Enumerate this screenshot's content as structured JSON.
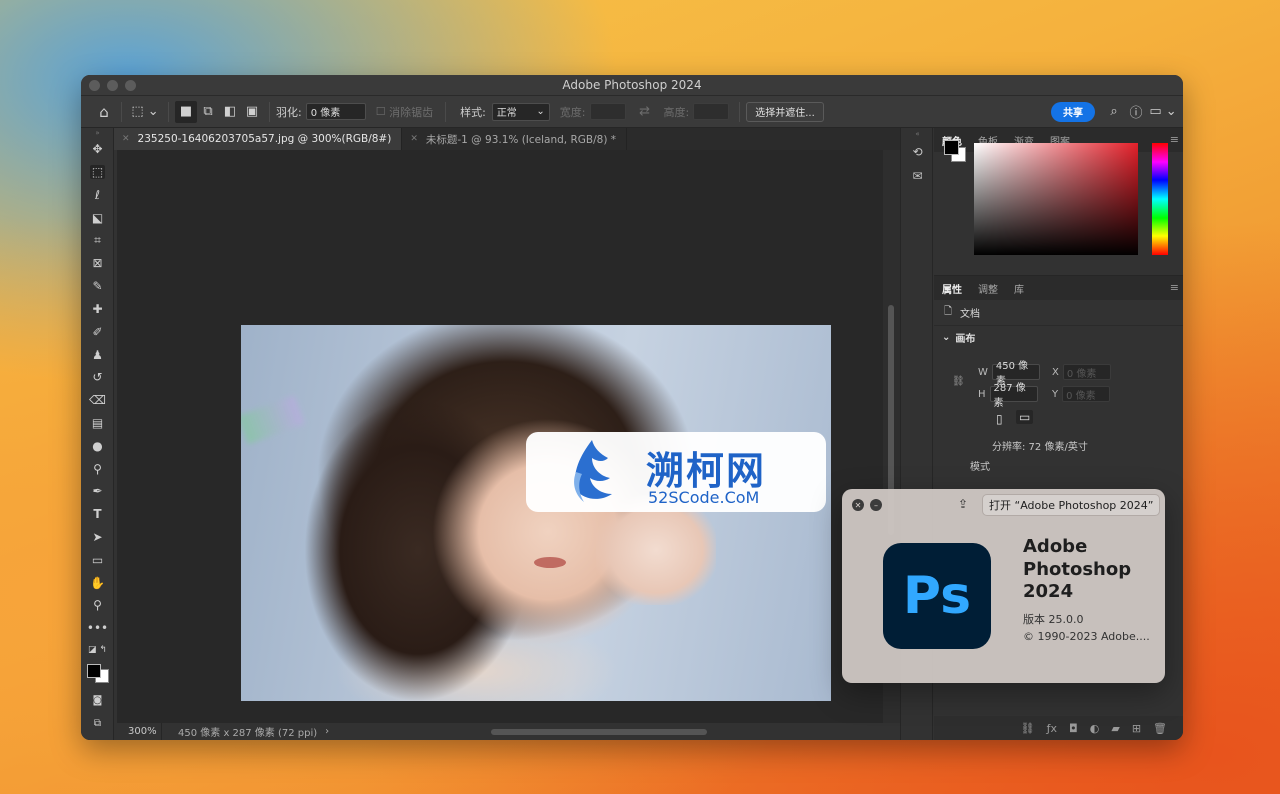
{
  "window": {
    "title": "Adobe Photoshop 2024"
  },
  "options": {
    "feather_label": "羽化:",
    "feather_value": "0 像素",
    "antialias_label": "消除锯齿",
    "style_label": "样式:",
    "style_value": "正常",
    "width_label": "宽度:",
    "height_label": "高度:",
    "select_mask_label": "选择并遮住...",
    "share_label": "共享"
  },
  "tabs": [
    {
      "label": "235250-16406203705a57.jpg @ 300%(RGB/8#)"
    },
    {
      "label": "未标题-1 @ 93.1% (Iceland, RGB/8) *"
    }
  ],
  "watermark": {
    "name": "溯柯网",
    "site": "52SCode.CoM"
  },
  "status": {
    "zoom": "300%",
    "info": "450 像素 x 287 像素 (72 ppi)",
    "arrow": "›"
  },
  "color_panel": {
    "tabs": [
      "颜色",
      "色板",
      "渐变",
      "图案"
    ],
    "accent": "#e4202a"
  },
  "properties_panel": {
    "tabs": [
      "属性",
      "调整",
      "库"
    ],
    "doc_label": "文档",
    "canvas_label": "画布",
    "w_label": "W",
    "w_value": "450 像素",
    "h_label": "H",
    "h_value": "287 像素",
    "x_label": "X",
    "x_value": "0 像素",
    "y_label": "Y",
    "y_value": "0 像素",
    "resolution": "分辨率: 72 像素/英寸",
    "mode_label": "模式"
  },
  "about": {
    "open_label": "打开 “Adobe Photoshop 2024”",
    "ps_mark": "Ps",
    "name": "Adobe Photoshop 2024",
    "version": "版本 25.0.0",
    "copyright": "© 1990-2023 Adobe...."
  }
}
